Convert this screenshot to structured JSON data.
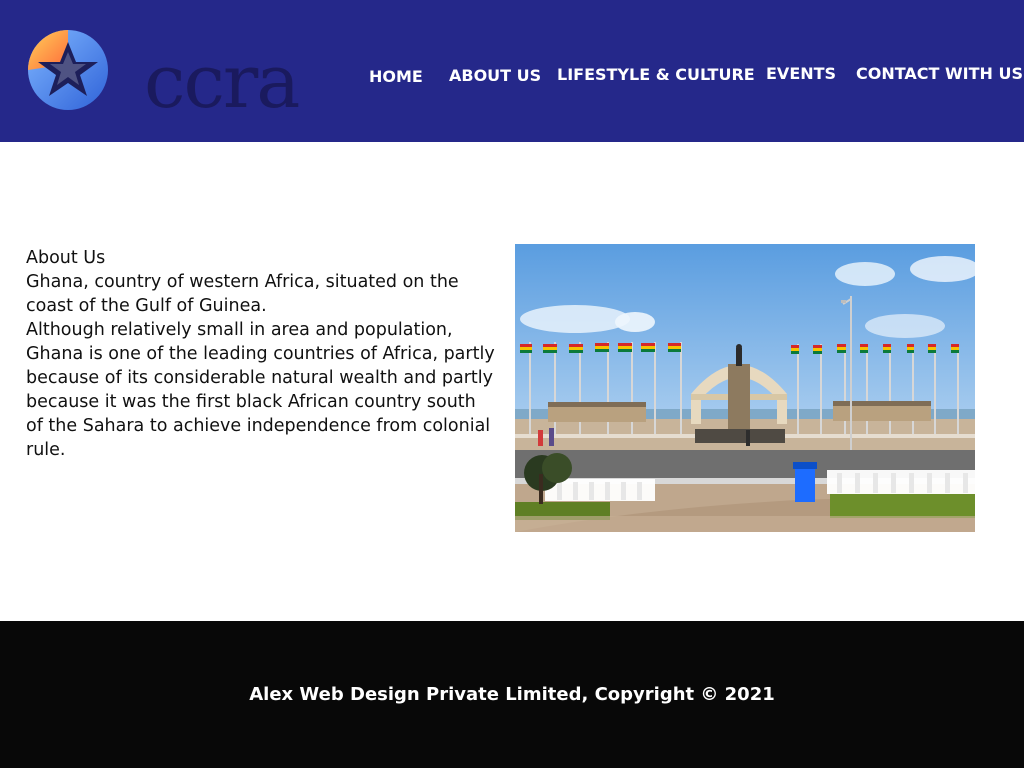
{
  "header": {
    "background_color": "#25288a",
    "logo": {
      "text": "ccra",
      "icon": "star-globe-icon"
    },
    "nav": [
      {
        "label": "HOME"
      },
      {
        "label": "ABOUT US"
      },
      {
        "label": "LIFESTYLE & CULTURE"
      },
      {
        "label": "EVENTS"
      },
      {
        "label": "CONTACT WITH US"
      }
    ]
  },
  "main": {
    "heading": "About Us",
    "paragraph1": "Ghana, country of western Africa, situated on the coast of the Gulf of Guinea.",
    "paragraph2": "Although relatively small in area and population, Ghana is one of the leading countries of Africa, partly because of its considerable natural wealth and partly because it was the first black African country south of the Sahara to achieve independence from colonial rule.",
    "image": {
      "subject": "independence-square-photo"
    }
  },
  "footer": {
    "background_color": "#080808",
    "text": "Alex Web Design Private Limited, Copyright © 2021"
  }
}
